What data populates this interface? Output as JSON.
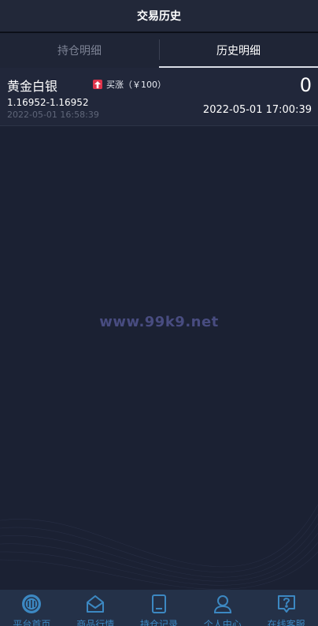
{
  "header": {
    "title": "交易历史"
  },
  "tabs": [
    {
      "label": "持仓明细",
      "active": false
    },
    {
      "label": "历史明细",
      "active": true
    }
  ],
  "records": [
    {
      "product": "黄金白银",
      "direction": "买涨（￥100）",
      "direction_icon": "up-arrow-icon",
      "result": "0",
      "price_range": "1.16952-1.16952",
      "open_time": "2022-05-01 16:58:39",
      "close_time": "2022-05-01 17:00:39"
    }
  ],
  "watermark": "www.99k9.net",
  "bottom_nav": [
    {
      "label": "平台首页",
      "icon": "home-logo-icon"
    },
    {
      "label": "商品行情",
      "icon": "envelope-icon"
    },
    {
      "label": "持仓记录",
      "icon": "tablet-icon"
    },
    {
      "label": "个人中心",
      "icon": "user-icon"
    },
    {
      "label": "在线客服",
      "icon": "help-icon"
    }
  ],
  "colors": {
    "background": "#1b2133",
    "accent": "#3c88c2",
    "up": "#e0344b"
  }
}
